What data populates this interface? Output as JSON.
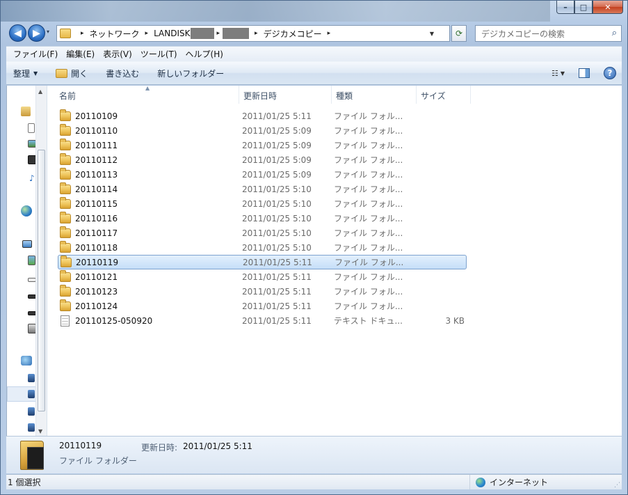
{
  "window": {
    "caption": {
      "minimize": "–",
      "maximize": "□",
      "close": "✕"
    }
  },
  "nav": {
    "back_icon": "◀",
    "forward_icon": "▶",
    "history_icon": "▾"
  },
  "address": {
    "crumbs": [
      "ネットワーク",
      "LANDISK",
      "デジカメコピー"
    ],
    "separator": "▸",
    "dropdown_icon": "▼",
    "refresh_icon": "⟳"
  },
  "search": {
    "placeholder": "デジカメコピーの検索",
    "icon": "⌕"
  },
  "menu": [
    "ファイル(F)",
    "編集(E)",
    "表示(V)",
    "ツール(T)",
    "ヘルプ(H)"
  ],
  "toolbar": {
    "organize": "整理",
    "open": "開く",
    "burn": "書き込む",
    "new_folder": "新しいフォルダー",
    "help": "?"
  },
  "columns": {
    "name": "名前",
    "date": "更新日時",
    "type": "種類",
    "size": "サイズ"
  },
  "files": [
    {
      "name": "20110109",
      "date": "2011/01/25 5:11",
      "type": "ファイル フォル...",
      "size": "",
      "kind": "folder"
    },
    {
      "name": "20110110",
      "date": "2011/01/25 5:09",
      "type": "ファイル フォル...",
      "size": "",
      "kind": "folder"
    },
    {
      "name": "20110111",
      "date": "2011/01/25 5:09",
      "type": "ファイル フォル...",
      "size": "",
      "kind": "folder"
    },
    {
      "name": "20110112",
      "date": "2011/01/25 5:09",
      "type": "ファイル フォル...",
      "size": "",
      "kind": "folder"
    },
    {
      "name": "20110113",
      "date": "2011/01/25 5:09",
      "type": "ファイル フォル...",
      "size": "",
      "kind": "folder"
    },
    {
      "name": "20110114",
      "date": "2011/01/25 5:10",
      "type": "ファイル フォル...",
      "size": "",
      "kind": "folder"
    },
    {
      "name": "20110115",
      "date": "2011/01/25 5:10",
      "type": "ファイル フォル...",
      "size": "",
      "kind": "folder"
    },
    {
      "name": "20110116",
      "date": "2011/01/25 5:10",
      "type": "ファイル フォル...",
      "size": "",
      "kind": "folder"
    },
    {
      "name": "20110117",
      "date": "2011/01/25 5:10",
      "type": "ファイル フォル...",
      "size": "",
      "kind": "folder"
    },
    {
      "name": "20110118",
      "date": "2011/01/25 5:10",
      "type": "ファイル フォル...",
      "size": "",
      "kind": "folder"
    },
    {
      "name": "20110119",
      "date": "2011/01/25 5:11",
      "type": "ファイル フォル...",
      "size": "",
      "kind": "folder",
      "selected": true
    },
    {
      "name": "20110121",
      "date": "2011/01/25 5:11",
      "type": "ファイル フォル...",
      "size": "",
      "kind": "folder"
    },
    {
      "name": "20110123",
      "date": "2011/01/25 5:11",
      "type": "ファイル フォル...",
      "size": "",
      "kind": "folder"
    },
    {
      "name": "20110124",
      "date": "2011/01/25 5:11",
      "type": "ファイル フォル...",
      "size": "",
      "kind": "folder"
    },
    {
      "name": "20110125-050920",
      "date": "2011/01/25 5:11",
      "type": "テキスト ドキュ...",
      "size": "3 KB",
      "kind": "text"
    }
  ],
  "details": {
    "name": "20110119",
    "type": "ファイル フォルダー",
    "modified_label": "更新日時:",
    "modified_value": "2011/01/25 5:11"
  },
  "status": {
    "selection": "1 個選択",
    "zone": "インターネット"
  },
  "colors": {
    "selection_fill": "#c5def8",
    "selection_border": "#7da2ce",
    "frame": "#b7cce6"
  }
}
